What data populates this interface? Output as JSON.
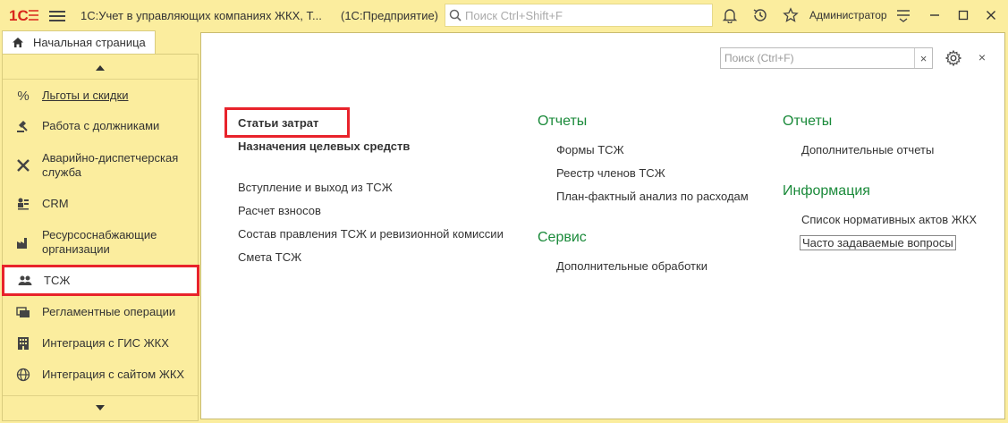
{
  "titlebar": {
    "logo_text": "1С",
    "title": "1С:Учет в управляющих компаниях ЖКХ, Т...",
    "app": "(1С:Предприятие)",
    "search_placeholder": "Поиск Ctrl+Shift+F",
    "user": "Администратор"
  },
  "tabs": {
    "home": "Начальная страница"
  },
  "sidebar": {
    "items": [
      {
        "label": "Льготы и скидки",
        "icon": "percent-icon"
      },
      {
        "label": "Работа с должниками",
        "icon": "gavel-icon"
      },
      {
        "label": "Аварийно-диспетчерская служба",
        "icon": "tools-icon"
      },
      {
        "label": "CRM",
        "icon": "crm-icon"
      },
      {
        "label": "Ресурсоснабжающие организации",
        "icon": "factory-icon"
      },
      {
        "label": "ТСЖ",
        "icon": "people-icon"
      },
      {
        "label": "Регламентные операции",
        "icon": "operations-icon"
      },
      {
        "label": "Интеграция с ГИС ЖКХ",
        "icon": "building-icon"
      },
      {
        "label": "Интеграция с сайтом ЖКХ",
        "icon": "globe-icon"
      }
    ]
  },
  "main": {
    "search_placeholder": "Поиск (Ctrl+F)",
    "clear_glyph": "×",
    "close_glyph": "×",
    "col1": {
      "bold_links": [
        "Статьи затрат",
        "Назначения целевых средств"
      ],
      "links": [
        "Вступление и выход из ТСЖ",
        "Расчет взносов",
        "Состав правления ТСЖ и ревизионной комиссии",
        "Смета ТСЖ"
      ]
    },
    "col2": {
      "heading1": "Отчеты",
      "links1": [
        "Формы ТСЖ",
        "Реестр членов ТСЖ",
        "План-фактный анализ по расходам"
      ],
      "heading2": "Сервис",
      "links2": [
        "Дополнительные обработки"
      ]
    },
    "col3": {
      "heading1": "Отчеты",
      "links1": [
        "Дополнительные отчеты"
      ],
      "heading2": "Информация",
      "links2": [
        "Список нормативных актов ЖКХ",
        "Часто задаваемые вопросы"
      ]
    }
  },
  "colors": {
    "accent_bg": "#fbed9e",
    "highlight": "#e8232b",
    "heading_green": "#1a8a3a"
  }
}
